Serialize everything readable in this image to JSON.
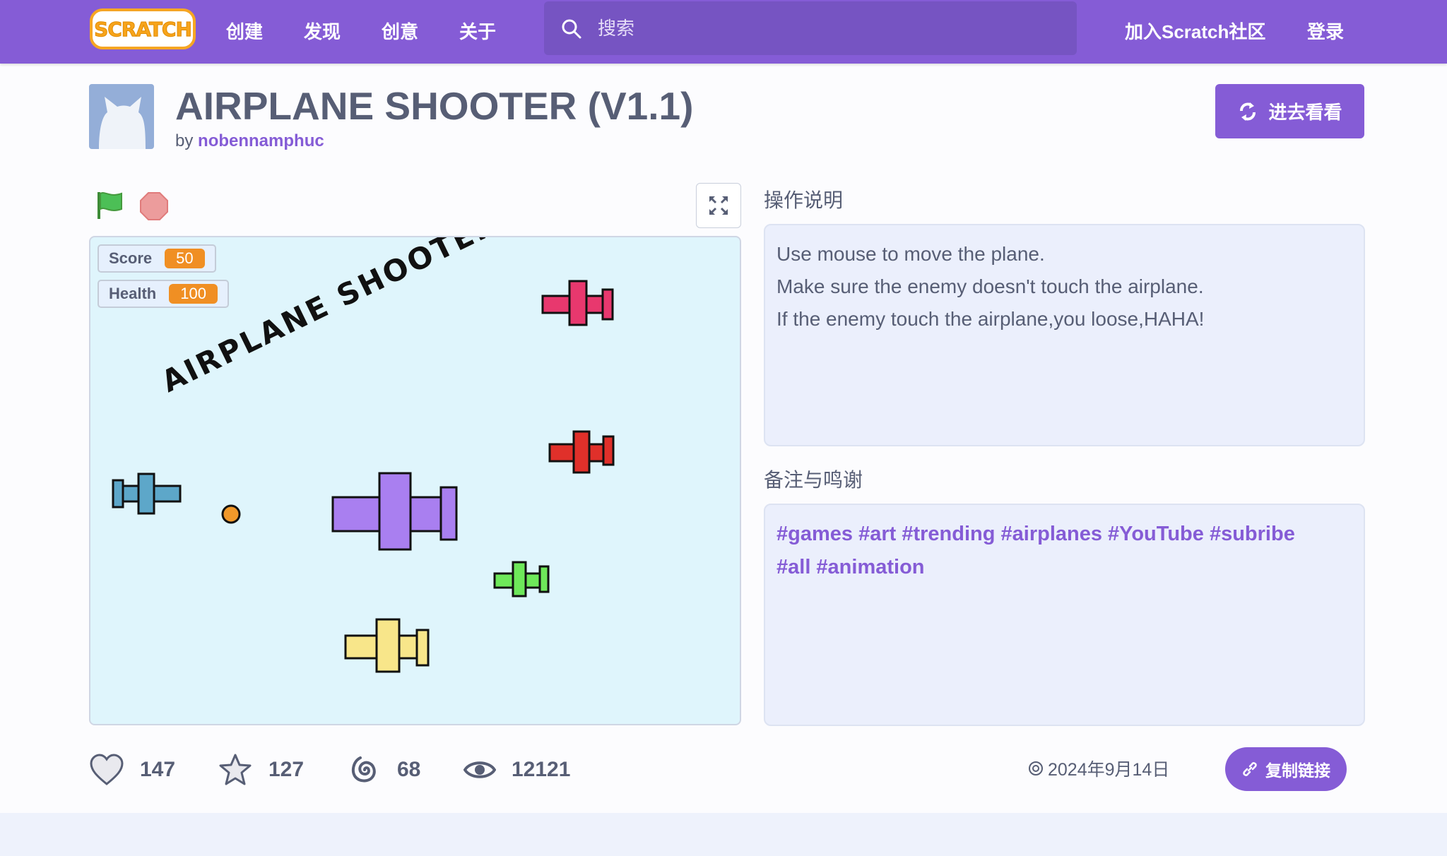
{
  "nav": {
    "logo_text": "SCRATCH",
    "links": [
      "创建",
      "发现",
      "创意",
      "关于"
    ],
    "search_placeholder": "搜索",
    "join": "加入Scratch社区",
    "login": "登录"
  },
  "project": {
    "title": "AIRPLANE SHOOTER (V1.1)",
    "by_label": "by",
    "author": "nobennamphuc",
    "see_inside": "进去看看"
  },
  "stage": {
    "monitors": [
      {
        "label": "Score",
        "value": "50"
      },
      {
        "label": "Health",
        "value": "100"
      }
    ],
    "game_title": "AIRPLANE SHOOTER"
  },
  "instructions": {
    "heading": "操作说明",
    "lines": [
      "Use mouse to move the plane.",
      "Make sure the enemy doesn't touch the airplane.",
      "If the enemy touch the airplane,you loose,HAHA!"
    ]
  },
  "notes": {
    "heading": "备注与鸣谢",
    "lines": [
      "#games #art #trending #airplanes #YouTube #subribe",
      "#all #animation"
    ]
  },
  "stats": {
    "loves": "147",
    "favorites": "127",
    "remixes": "68",
    "views": "12121"
  },
  "meta": {
    "date": "2024年9月14日",
    "copy_link": "复制链接"
  },
  "colors": {
    "brand": "#855cd6",
    "stage_bg": "#dff5fc",
    "monitor_value": "#f08f23"
  }
}
